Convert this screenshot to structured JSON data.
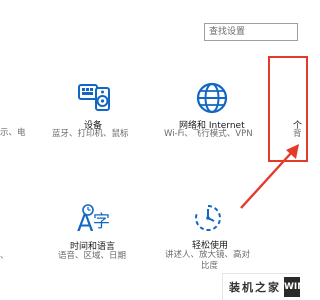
{
  "search": {
    "placeholder": "查找设置"
  },
  "tiles": {
    "system": {
      "desc": "示、电"
    },
    "devices": {
      "title": "设备",
      "desc": "蓝牙、打印机、鼠标",
      "icon": "keyboard-speaker-icon"
    },
    "network": {
      "title": "网络和 Internet",
      "desc": "Wi-Fi、飞行模式、VPN",
      "icon": "globe-icon"
    },
    "personalization": {
      "title": "个",
      "desc": "背"
    },
    "accounts": {
      "desc": "、"
    },
    "time_language": {
      "title": "时间和语言",
      "desc": "语音、区域、日期",
      "icon": "time-language-icon"
    },
    "ease_of_access": {
      "title": "轻松使用",
      "desc_line1": "讲述人、放大镜、高对",
      "desc_line2": "比度",
      "icon": "ease-of-access-icon"
    }
  },
  "annotation": {
    "color": "#e5392a"
  },
  "watermark": {
    "text": "装机之家",
    "logo": "WIN"
  }
}
